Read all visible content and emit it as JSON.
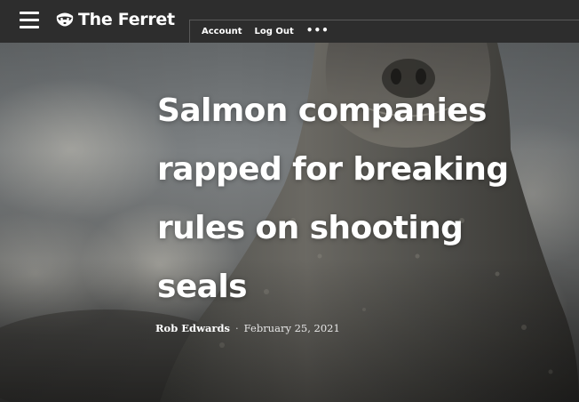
{
  "header": {
    "brand": "The Ferret",
    "nav": {
      "account_label": "Account",
      "logout_label": "Log Out",
      "more_label": "•••"
    },
    "icons": {
      "menu": "hamburger-menu-icon",
      "logo": "ferret-logo-icon"
    }
  },
  "article": {
    "headline_lines": [
      "Salmon companies",
      "rapped for breaking",
      "rules on shooting",
      "seals"
    ],
    "author": "Rob Edwards",
    "separator": "·",
    "date": "February 25, 2021",
    "hero_image": "grey seal photo"
  },
  "colors": {
    "topbar": "#2d2d2d",
    "text": "#ffffff",
    "rule": "#595959"
  }
}
